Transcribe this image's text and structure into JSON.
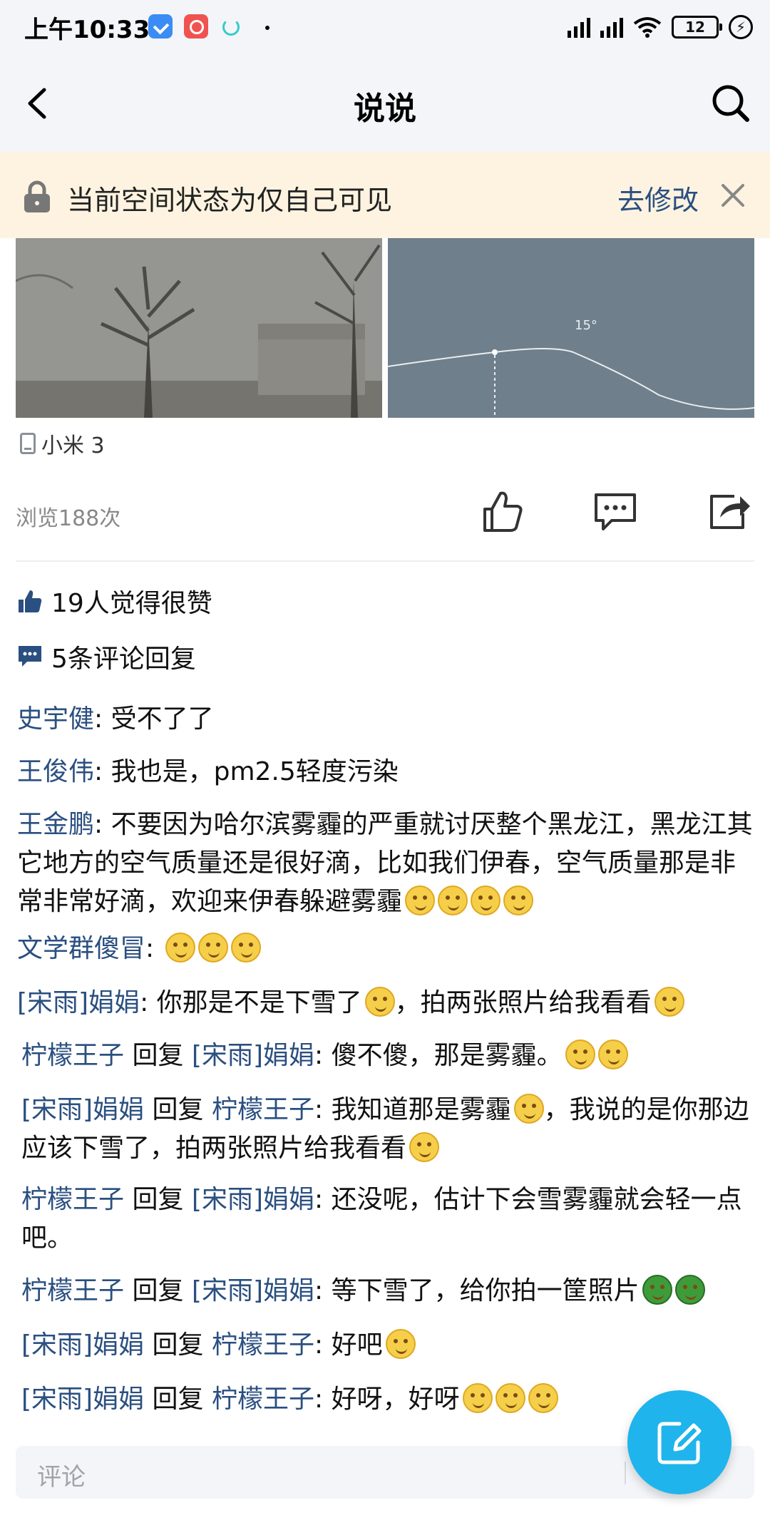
{
  "status_bar": {
    "time": "上午10:33",
    "battery": "12"
  },
  "nav": {
    "title": "说说"
  },
  "notice": {
    "text": "当前空间状态为仅自己可见",
    "action": "去修改"
  },
  "photos": {
    "chart_label": "15°"
  },
  "post": {
    "device": "小米 3",
    "views": "浏览188次",
    "likes": "19人觉得很赞",
    "comments_count": "5条评论回复"
  },
  "comments": [
    {
      "name": "史宇健",
      "text": ": 受不了了",
      "emojis": 0
    },
    {
      "name": "王俊伟",
      "text": ": 我也是，pm2.5轻度污染",
      "emojis": 0
    },
    {
      "name": "王金鹏",
      "text": ": 不要因为哈尔滨雾霾的严重就讨厌整个黑龙江，黑龙江其它地方的空气质量还是很好滴，比如我们伊春，空气质量那是非常非常好滴，欢迎来伊春躲避雾霾",
      "emojis": 4
    },
    {
      "name": "文学群傻冒",
      "text": ": ",
      "emojis": 3
    },
    {
      "name": "[宋雨]娟娟",
      "text": ": 你那是不是下雪了",
      "mid_emoji": true,
      "text2": "，拍两张照片给我看看",
      "emojis": 1
    }
  ],
  "replies": [
    {
      "from": "柠檬王子",
      "verb": " 回复 ",
      "to": "[宋雨]娟娟",
      "text": ":  傻不傻，那是雾霾。",
      "emojis": 2
    },
    {
      "from": "[宋雨]娟娟",
      "verb": " 回复 ",
      "to": "柠檬王子",
      "text": ": 我知道那是雾霾",
      "mid_emoji": true,
      "text2": "，我说的是你那边应该下雪了，拍两张照片给我看看",
      "emojis": 1
    },
    {
      "from": "柠檬王子",
      "verb": " 回复 ",
      "to": "[宋雨]娟娟",
      "text": ": 还没呢，估计下会雪雾霾就会轻一点吧。",
      "emojis": 0
    },
    {
      "from": "柠檬王子",
      "verb": " 回复 ",
      "to": "[宋雨]娟娟",
      "text": ": 等下雪了，给你拍一筐照片",
      "emojis": 2,
      "emoji_style": "turtle"
    },
    {
      "from": "[宋雨]娟娟",
      "verb": " 回复 ",
      "to": "柠檬王子",
      "text": ": 好吧",
      "emojis": 1
    },
    {
      "from": "[宋雨]娟娟",
      "verb": " 回复 ",
      "to": "柠檬王子",
      "text": ": 好呀，好呀",
      "emojis": 3
    }
  ],
  "input": {
    "placeholder": "评论"
  },
  "colors": {
    "link": "#2a4f80",
    "fab": "#1fb4ec",
    "notice_bg": "#fdf3e0"
  },
  "icons": [
    "back-arrow-icon",
    "search-icon",
    "lock-icon",
    "close-icon",
    "phone-icon",
    "thumbs-up-icon",
    "comment-icon",
    "share-icon",
    "compose-icon"
  ]
}
